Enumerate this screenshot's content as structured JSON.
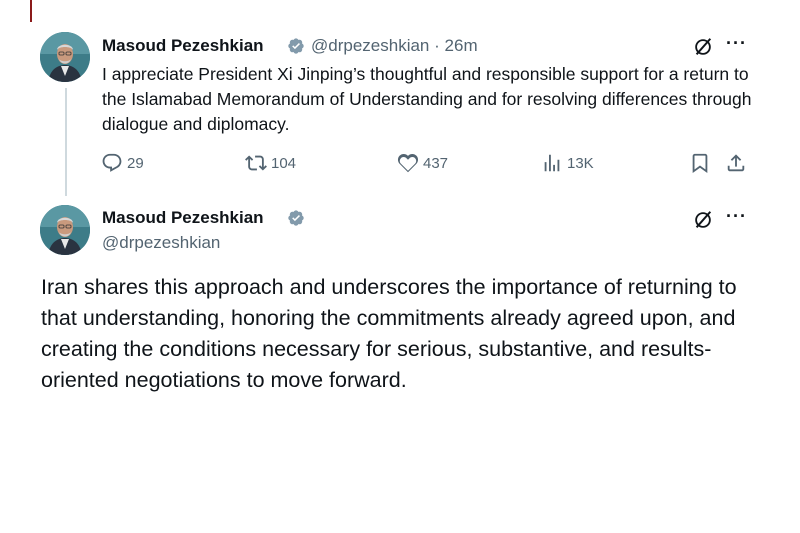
{
  "thread": {
    "parent_tweet": {
      "author_name": "Masoud Pezeshkian",
      "handle": "@drpezeshkian",
      "separator": "·",
      "time": "26m",
      "text": "I appreciate President Xi Jinping’s thoughtful and responsible support for a return to the Islamabad Memorandum of Understanding and for resolving differences through dialogue and diplomacy.",
      "metrics": {
        "replies": "29",
        "reposts": "104",
        "likes": "437",
        "views": "13K"
      },
      "more_label": "···"
    },
    "reply_tweet": {
      "author_name": "Masoud Pezeshkian",
      "handle": "@drpezeshkian",
      "text": "Iran shares this approach and underscores the importance of returning to that understanding, honoring the commitments already agreed upon, and creating the conditions necessary for serious, substantive, and results-oriented negotiations to move forward.",
      "more_label": "···"
    }
  },
  "icons": {
    "verified": "verified-badge-icon",
    "grok": "grok-icon",
    "more": "more-icon",
    "reply": "reply-icon",
    "repost": "repost-icon",
    "like": "like-icon",
    "views": "views-icon",
    "bookmark": "bookmark-icon",
    "share": "share-icon"
  },
  "colors": {
    "text_primary": "#0f1419",
    "text_secondary": "#536471",
    "verified_badge": "#829aab",
    "thread_line": "#cfd9de"
  }
}
